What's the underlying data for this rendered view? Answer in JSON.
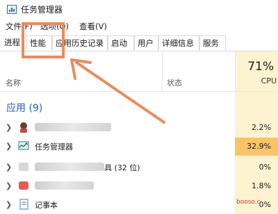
{
  "window": {
    "title": "任务管理器"
  },
  "menu": [
    "文件(F)",
    "选项(O)",
    "查看(V)"
  ],
  "tabs": [
    "进程",
    "性能",
    "应用历史记录",
    "启动",
    "用户",
    "详细信息",
    "服务"
  ],
  "columns": {
    "name": "名称",
    "status": "状态",
    "cpu_percent": "71%",
    "cpu_label": "CPU"
  },
  "group": {
    "label": "应用 (9)"
  },
  "rows": [
    {
      "name": "",
      "cpu": "2.2%",
      "cpu_bg": "#fdf3d0",
      "icon": "avatar-icon"
    },
    {
      "name": "任务管理器",
      "cpu": "32.9%",
      "cpu_bg": "#f7c468",
      "icon": "task-manager-icon"
    },
    {
      "name": "具 (32 位)",
      "cpu": "0%",
      "cpu_bg": "#fdf3d0",
      "icon": "app-icon"
    },
    {
      "name": "",
      "cpu": "1.8%",
      "cpu_bg": "#fdf3d0",
      "icon": "app-icon"
    },
    {
      "name": "记事本",
      "cpu": "0%",
      "cpu_bg": "#fdf3d0",
      "icon": "notepad-icon"
    }
  ],
  "watermark": "booso.c",
  "colors": {
    "highlight": "#ec8a5c",
    "group": "#1f5fb4",
    "cpu_high": "#f7c468",
    "cpu_low": "#fdf3d0"
  }
}
